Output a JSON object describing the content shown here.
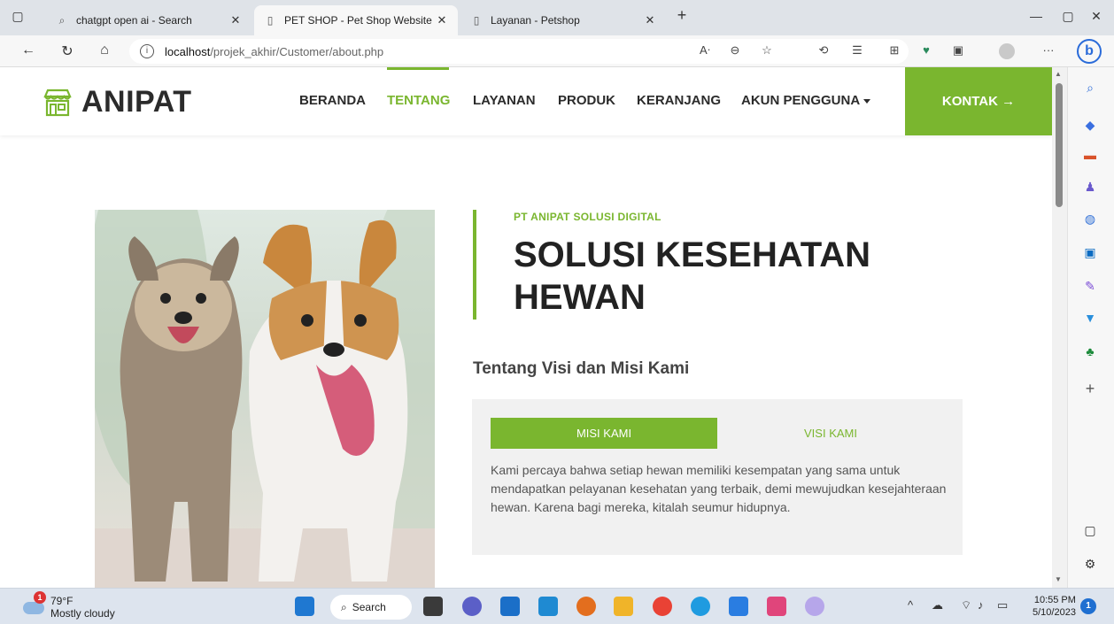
{
  "browser": {
    "tabs": [
      {
        "label": "chatgpt open ai - Search",
        "icon": "search-icon"
      },
      {
        "label": "PET SHOP - Pet Shop Website Te",
        "icon": "page-icon"
      },
      {
        "label": "Layanan - Petshop",
        "icon": "page-icon"
      }
    ],
    "new_tab": "+",
    "url_host": "localhost",
    "url_path": "/projek_akhir/Customer/about.php",
    "accent": "#2a6bd9"
  },
  "site": {
    "brand": "ANIPAT",
    "accent": "#7ab62f",
    "nav": [
      "BERANDA",
      "TENTANG",
      "LAYANAN",
      "PRODUK",
      "KERANJANG",
      "AKUN PENGGUNA"
    ],
    "active_nav": "TENTANG",
    "contact": "KONTAK →"
  },
  "about": {
    "eyebrow": "PT ANIPAT SOLUSI DIGITAL",
    "headline": "SOLUSI KESEHATAN HEWAN",
    "subhead": "Tentang Visi dan Misi Kami",
    "tabs": {
      "misi": "MISI KAMI",
      "visi": "VISI KAMI"
    },
    "active_tab": "MISI KAMI",
    "body": "Kami percaya bahwa setiap hewan memiliki kesempatan yang sama untuk mendapatkan pelayanan kesehatan yang terbaik, demi mewujudkan kesejahteraan hewan. Karena bagi mereka, kitalah seumur hidupnya."
  },
  "taskbar": {
    "weather_badge": "1",
    "temp": "79°F",
    "condition": "Mostly cloudy",
    "search": "Search",
    "time": "10:55 PM",
    "date": "5/10/2023",
    "notifications": "1"
  }
}
